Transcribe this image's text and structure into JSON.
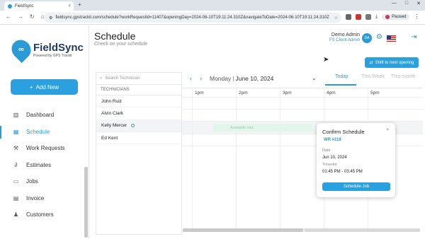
{
  "browser": {
    "tab_title": "FieldSync",
    "tab_close": "×",
    "new_tab": "+",
    "window_controls": [
      "—",
      "□",
      "✕"
    ],
    "url": "fieldsync.gpstrackit.com/schedule?workRequestId=11407&openingDay=2024-06-10T19:11:24.310Z&navigateToDate=2024-06-10T19:11:24.310Z",
    "profile_status": "Paused"
  },
  "sidebar": {
    "brand": "FieldSync",
    "tagline": "Powered by GPS Trackit",
    "add_new_label": "Add New",
    "items": [
      {
        "label": "Dashboard",
        "icon": "dashboard-icon"
      },
      {
        "label": "Schedule",
        "icon": "calendar-icon",
        "active": true
      },
      {
        "label": "Work Requests",
        "icon": "wrench-icon"
      },
      {
        "label": "Estimates",
        "icon": "paperclip-icon"
      },
      {
        "label": "Jobs",
        "icon": "document-icon"
      },
      {
        "label": "Invoice",
        "icon": "invoice-icon"
      },
      {
        "label": "Customers",
        "icon": "people-icon"
      }
    ]
  },
  "header": {
    "title": "Schedule",
    "subtitle": "Check on your schedule",
    "user_name": "Demo Admin",
    "user_role": "FS Client Admin",
    "avatar_initials": "DA",
    "shift_label": "Shift to next opening"
  },
  "technicians": {
    "search_placeholder": "Search Technician",
    "column_header": "TECHNICIANS",
    "rows": [
      "John Ruiz",
      "Alvin Clark",
      "Kelly Mercer",
      "Ed Kent"
    ]
  },
  "calendar": {
    "day": "Monday",
    "date": "June 10, 2024",
    "views": [
      "Today",
      "This Week",
      "This month"
    ],
    "active_view": "Today",
    "hours": [
      "1pm",
      "2pm",
      "3pm",
      "4pm",
      "5pm"
    ],
    "available_slot_label": "Available slot"
  },
  "modal": {
    "title": "Confirm Schedule",
    "close": "×",
    "work_request": "WR #118",
    "date_label": "Date",
    "date_value": "Jun 10, 2024",
    "timeslot_label": "Timeslot",
    "timeslot_value": "01:45 PM - 03:45 PM",
    "button_label": "Schedule Job"
  },
  "colors": {
    "accent": "#2aa0de",
    "available": "#e3f6ec"
  }
}
